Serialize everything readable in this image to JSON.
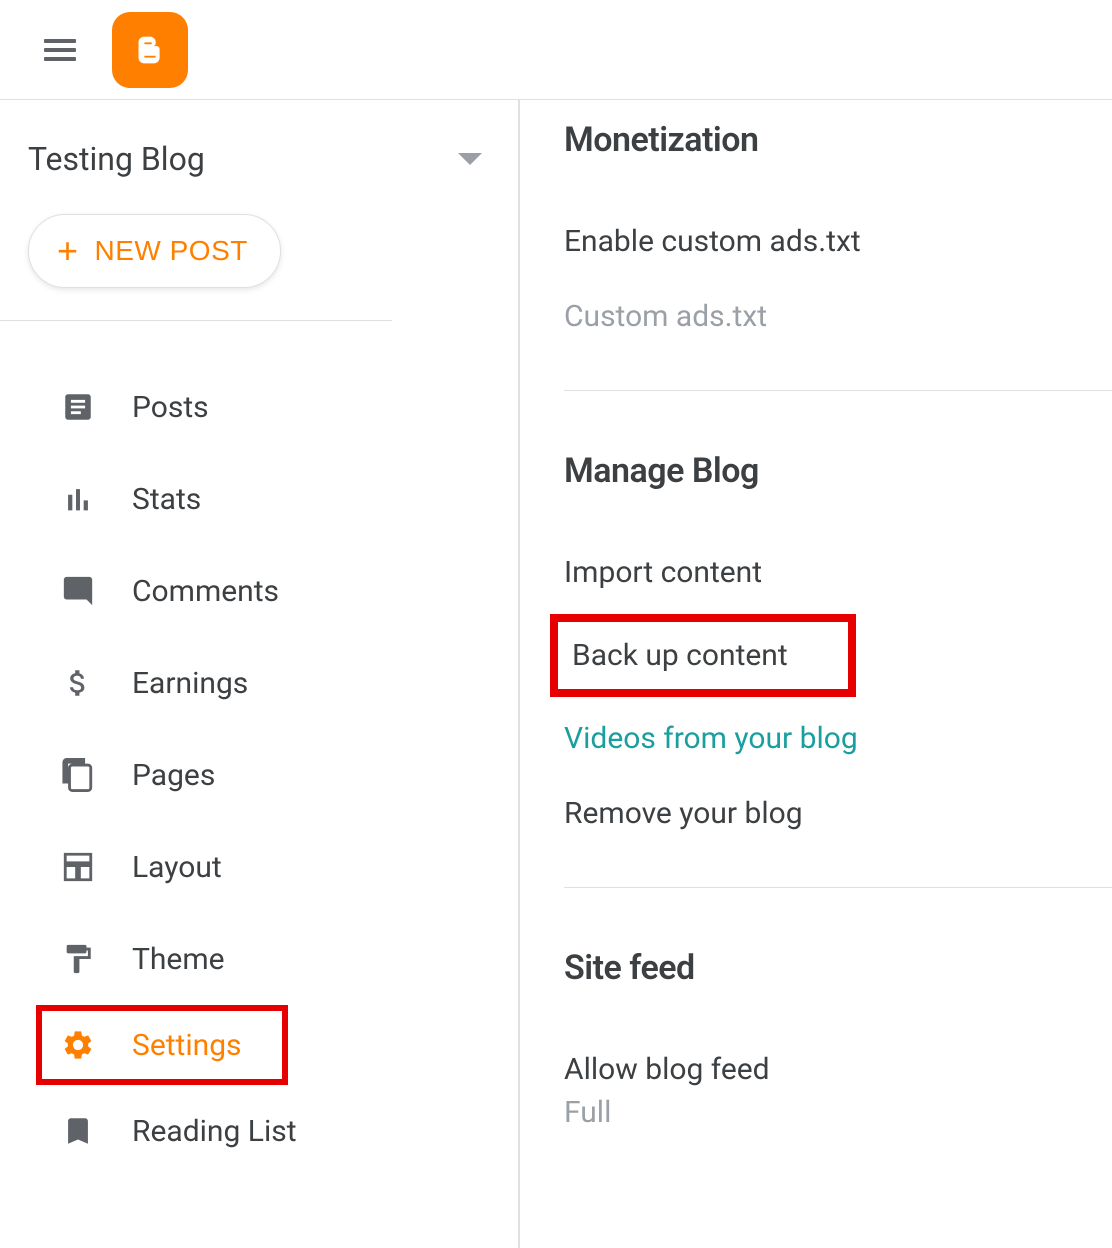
{
  "header": {
    "logo_alt": "Blogger"
  },
  "sidebar": {
    "blog_title": "Testing Blog",
    "new_post_label": "NEW POST",
    "nav": [
      {
        "key": "posts",
        "label": "Posts"
      },
      {
        "key": "stats",
        "label": "Stats"
      },
      {
        "key": "comments",
        "label": "Comments"
      },
      {
        "key": "earnings",
        "label": "Earnings"
      },
      {
        "key": "pages",
        "label": "Pages"
      },
      {
        "key": "layout",
        "label": "Layout"
      },
      {
        "key": "theme",
        "label": "Theme"
      },
      {
        "key": "settings",
        "label": "Settings"
      },
      {
        "key": "reading_list",
        "label": "Reading List"
      }
    ]
  },
  "main": {
    "monetization": {
      "heading": "Monetization",
      "enable_ads_txt": "Enable custom ads.txt",
      "custom_ads_txt": "Custom ads.txt"
    },
    "manage_blog": {
      "heading": "Manage Blog",
      "import_content": "Import content",
      "backup_content": "Back up content",
      "videos": "Videos from your blog",
      "remove": "Remove your blog"
    },
    "site_feed": {
      "heading": "Site feed",
      "allow_label": "Allow blog feed",
      "allow_value": "Full"
    }
  }
}
